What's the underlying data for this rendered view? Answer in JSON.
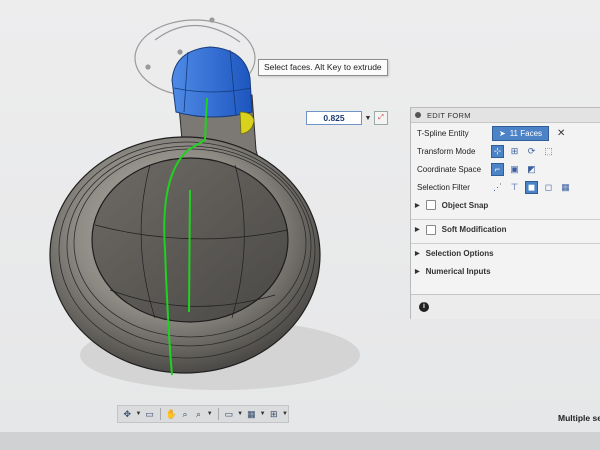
{
  "tooltip": {
    "text": "Select faces. Alt Key to extrude"
  },
  "value_input": {
    "value": "0.825"
  },
  "edit_form": {
    "title": "EDIT FORM",
    "rows": {
      "tspline_entity": {
        "label": "T-Spline Entity",
        "selection": "11 Faces"
      },
      "transform_mode": {
        "label": "Transform Mode"
      },
      "coordinate_space": {
        "label": "Coordinate Space"
      },
      "selection_filter": {
        "label": "Selection Filter"
      }
    },
    "sections": {
      "object_snap": "Object Snap",
      "soft_modification": "Soft Modification",
      "selection_options": "Selection Options",
      "numerical_inputs": "Numerical Inputs"
    }
  },
  "status": {
    "text": "Multiple se"
  },
  "colors": {
    "accent": "#4b83c6",
    "highlight_blue": "#2d6ad0",
    "highlight_yellow": "#d9d21c",
    "edge_green": "#1fd21f"
  },
  "icons": [
    "close-icon",
    "cursor-icon",
    "orbit-icon",
    "pan-icon",
    "zoom-icon",
    "display-icon",
    "grid-icon",
    "info-icon"
  ]
}
